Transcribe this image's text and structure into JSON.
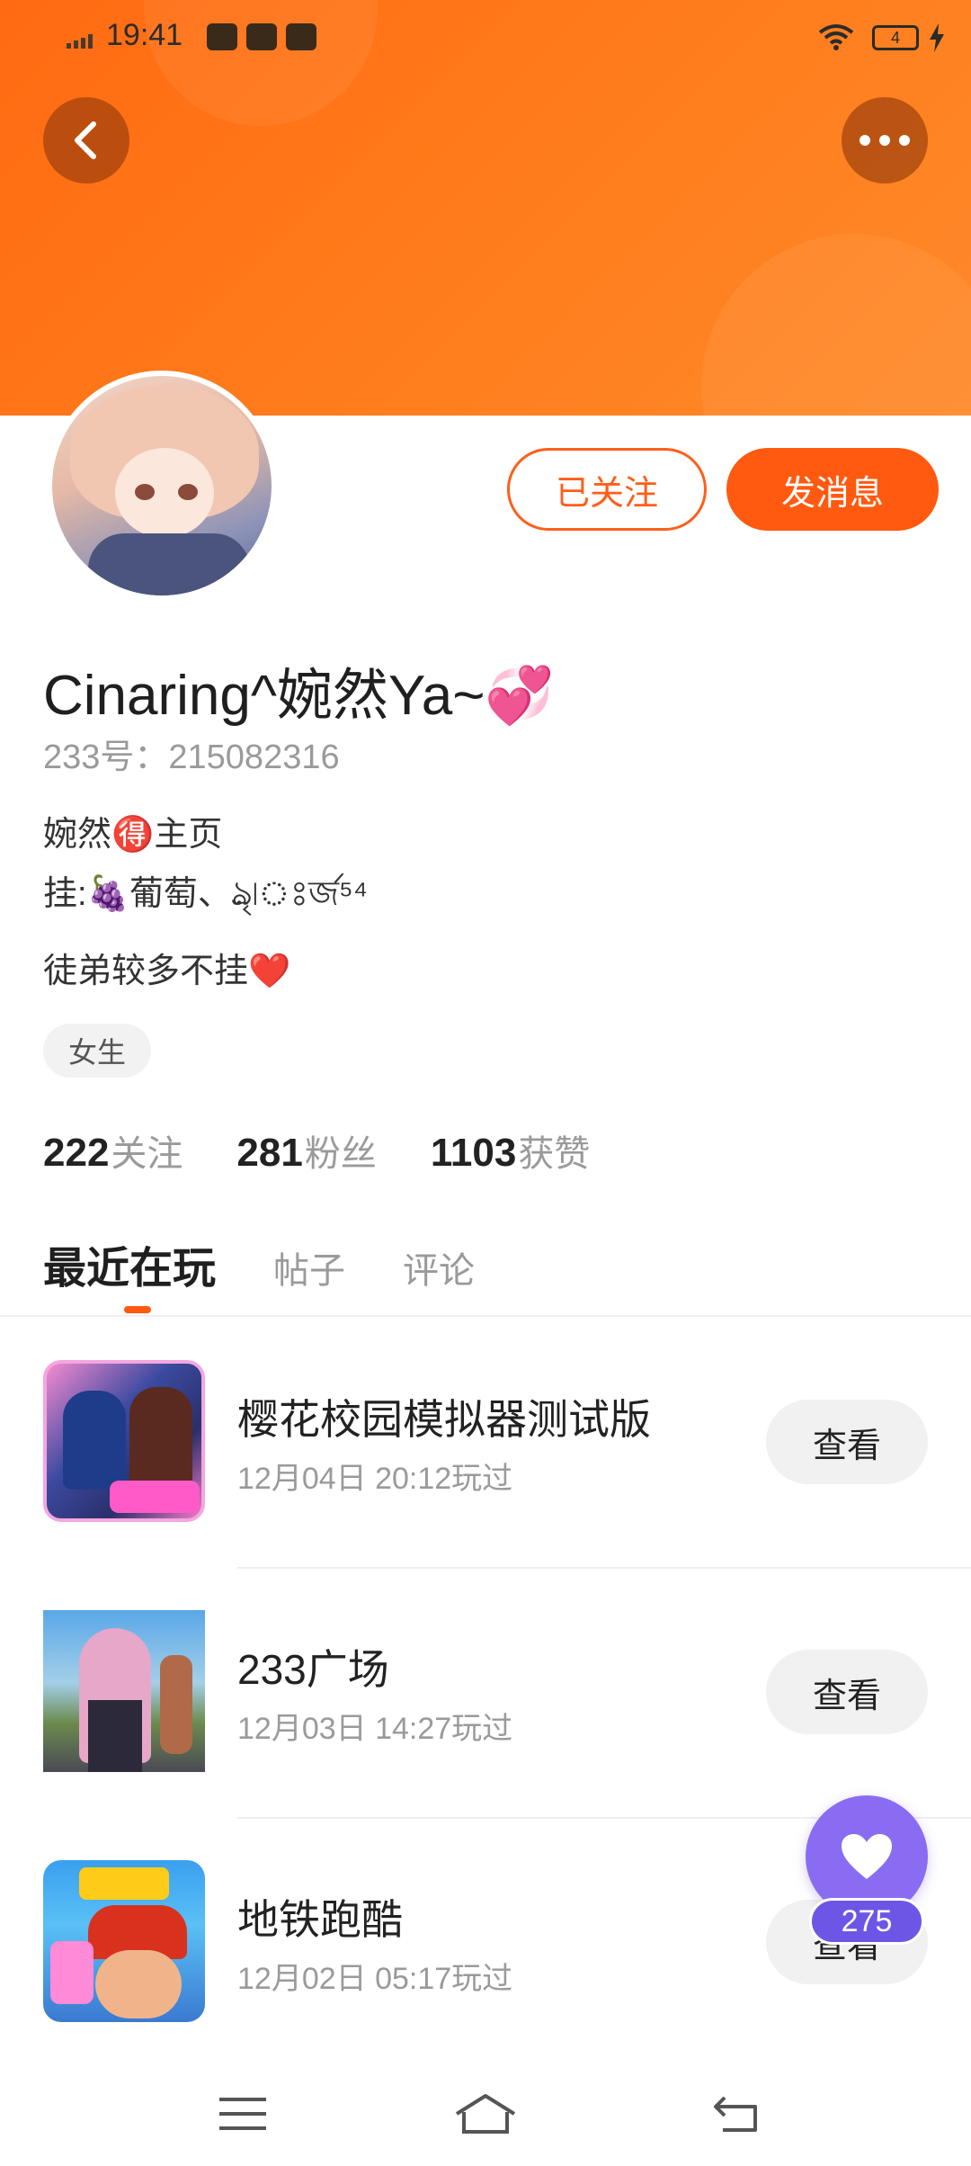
{
  "status_bar": {
    "time": "19:41",
    "battery": "4",
    "icons": [
      "signal-icon",
      "video-icon",
      "book-icon",
      "play-icon",
      "wifi-icon",
      "battery-icon",
      "charge-icon"
    ]
  },
  "header": {
    "back_icon": "chevron-left-icon",
    "more_icon": "more-dots-icon",
    "banner_color": "#ff6a12"
  },
  "profile": {
    "username": "Cinaring^婉然Ya~💞",
    "user_id": "233号：215082316",
    "bio_lines": [
      "婉然🉐主页",
      "挂:🍇葡萄、ঌ্রৃ৷ঃর্জ⁵⁴",
      "徒弟较多不挂❤️"
    ],
    "gender_tag": "女生",
    "follow_button": "已关注",
    "message_button": "发消息"
  },
  "stats": [
    {
      "value": "222",
      "label": "关注"
    },
    {
      "value": "281",
      "label": "粉丝"
    },
    {
      "value": "1103",
      "label": "获赞"
    }
  ],
  "tabs": [
    {
      "label": "最近在玩",
      "active": true
    },
    {
      "label": "帖子",
      "active": false
    },
    {
      "label": "评论",
      "active": false
    }
  ],
  "games": [
    {
      "name": "樱花校园模拟器测试版",
      "played": "12月04日 20:12玩过",
      "button": "查看"
    },
    {
      "name": "233广场",
      "played": "12月03日 14:27玩过",
      "button": "查看"
    },
    {
      "name": "地铁跑酷",
      "played": "12月02日 05:17玩过",
      "button": "查看"
    }
  ],
  "fab": {
    "icon": "heart-icon",
    "count": "275",
    "color": "#8a6cf3"
  },
  "colors": {
    "accent": "#ff5a10"
  }
}
